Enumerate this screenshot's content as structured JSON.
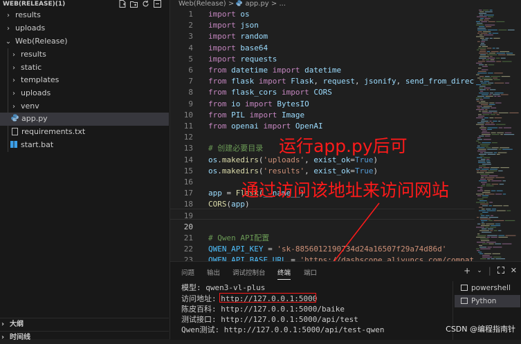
{
  "explorer": {
    "title": "WEB(RELEASE)(1)",
    "items": [
      {
        "label": "results",
        "type": "folder",
        "expanded": false,
        "depth": 0
      },
      {
        "label": "uploads",
        "type": "folder",
        "expanded": false,
        "depth": 0
      },
      {
        "label": "Web(Release)",
        "type": "folder",
        "expanded": true,
        "depth": 0
      },
      {
        "label": "results",
        "type": "folder",
        "expanded": false,
        "depth": 1
      },
      {
        "label": "static",
        "type": "folder",
        "expanded": false,
        "depth": 1
      },
      {
        "label": "templates",
        "type": "folder",
        "expanded": false,
        "depth": 1
      },
      {
        "label": "uploads",
        "type": "folder",
        "expanded": false,
        "depth": 1
      },
      {
        "label": "venv",
        "type": "folder",
        "expanded": false,
        "depth": 1
      },
      {
        "label": "app.py",
        "type": "python",
        "selected": true,
        "depth": 1
      },
      {
        "label": "requirements.txt",
        "type": "text",
        "depth": 1
      },
      {
        "label": "start.bat",
        "type": "windows",
        "depth": 1
      }
    ],
    "outline_label": "大纲",
    "timeline_label": "时间线"
  },
  "editor": {
    "breadcrumb_folder": "Web(Release)",
    "breadcrumb_sep": ">",
    "breadcrumb_file": "app.py",
    "breadcrumb_more": "> ...",
    "current_line": 20,
    "lines": [
      {
        "n": "1",
        "tokens": [
          {
            "t": "import",
            "c": "kw"
          },
          {
            "t": " os",
            "c": "vr"
          }
        ]
      },
      {
        "n": "2",
        "tokens": [
          {
            "t": "import",
            "c": "kw"
          },
          {
            "t": " json",
            "c": "vr"
          }
        ]
      },
      {
        "n": "3",
        "tokens": [
          {
            "t": "import",
            "c": "kw"
          },
          {
            "t": " random",
            "c": "vr"
          }
        ]
      },
      {
        "n": "4",
        "tokens": [
          {
            "t": "import",
            "c": "kw"
          },
          {
            "t": " base64",
            "c": "vr"
          }
        ]
      },
      {
        "n": "5",
        "tokens": [
          {
            "t": "import",
            "c": "kw"
          },
          {
            "t": " requests",
            "c": "vr"
          }
        ]
      },
      {
        "n": "6",
        "tokens": [
          {
            "t": "from",
            "c": "kw"
          },
          {
            "t": " datetime ",
            "c": "vr"
          },
          {
            "t": "import",
            "c": "kw"
          },
          {
            "t": " datetime",
            "c": "vr"
          }
        ]
      },
      {
        "n": "7",
        "tokens": [
          {
            "t": "from",
            "c": "kw"
          },
          {
            "t": " flask ",
            "c": "vr"
          },
          {
            "t": "import",
            "c": "kw"
          },
          {
            "t": " Flask",
            "c": "vr"
          },
          {
            "t": ", ",
            "c": "pl"
          },
          {
            "t": "request",
            "c": "vr"
          },
          {
            "t": ", ",
            "c": "pl"
          },
          {
            "t": "jsonify",
            "c": "vr"
          },
          {
            "t": ", ",
            "c": "pl"
          },
          {
            "t": "send_from_director",
            "c": "vr"
          }
        ]
      },
      {
        "n": "8",
        "tokens": [
          {
            "t": "from",
            "c": "kw"
          },
          {
            "t": " flask_cors ",
            "c": "vr"
          },
          {
            "t": "import",
            "c": "kw"
          },
          {
            "t": " CORS",
            "c": "vr"
          }
        ]
      },
      {
        "n": "9",
        "tokens": [
          {
            "t": "from",
            "c": "kw"
          },
          {
            "t": " io ",
            "c": "vr"
          },
          {
            "t": "import",
            "c": "kw"
          },
          {
            "t": " BytesIO",
            "c": "vr"
          }
        ]
      },
      {
        "n": "10",
        "tokens": [
          {
            "t": "from",
            "c": "kw"
          },
          {
            "t": " PIL ",
            "c": "vr"
          },
          {
            "t": "import",
            "c": "kw"
          },
          {
            "t": " Image",
            "c": "vr"
          }
        ]
      },
      {
        "n": "11",
        "tokens": [
          {
            "t": "from",
            "c": "kw"
          },
          {
            "t": " openai ",
            "c": "vr"
          },
          {
            "t": "import",
            "c": "kw"
          },
          {
            "t": " OpenAI",
            "c": "vr"
          }
        ]
      },
      {
        "n": "12",
        "tokens": []
      },
      {
        "n": "13",
        "tokens": [
          {
            "t": "# 创建必要目录",
            "c": "cm"
          }
        ]
      },
      {
        "n": "14",
        "tokens": [
          {
            "t": "os",
            "c": "vr"
          },
          {
            "t": ".",
            "c": "pl"
          },
          {
            "t": "makedirs",
            "c": "fn"
          },
          {
            "t": "(",
            "c": "pl"
          },
          {
            "t": "'uploads'",
            "c": "st"
          },
          {
            "t": ", ",
            "c": "pl"
          },
          {
            "t": "exist_ok",
            "c": "vr"
          },
          {
            "t": "=",
            "c": "pl"
          },
          {
            "t": "True",
            "c": "bl"
          },
          {
            "t": ")",
            "c": "pl"
          }
        ]
      },
      {
        "n": "15",
        "tokens": [
          {
            "t": "os",
            "c": "vr"
          },
          {
            "t": ".",
            "c": "pl"
          },
          {
            "t": "makedirs",
            "c": "fn"
          },
          {
            "t": "(",
            "c": "pl"
          },
          {
            "t": "'results'",
            "c": "st"
          },
          {
            "t": ", ",
            "c": "pl"
          },
          {
            "t": "exist_ok",
            "c": "vr"
          },
          {
            "t": "=",
            "c": "pl"
          },
          {
            "t": "True",
            "c": "bl"
          },
          {
            "t": ")",
            "c": "pl"
          }
        ]
      },
      {
        "n": "16",
        "tokens": []
      },
      {
        "n": "17",
        "tokens": [
          {
            "t": "app",
            "c": "vr"
          },
          {
            "t": " = ",
            "c": "pl"
          },
          {
            "t": "Flask",
            "c": "fn"
          },
          {
            "t": "(",
            "c": "pl"
          },
          {
            "t": "__name__",
            "c": "vr"
          },
          {
            "t": ")",
            "c": "pl"
          }
        ]
      },
      {
        "n": "18",
        "tokens": [
          {
            "t": "CORS",
            "c": "fn"
          },
          {
            "t": "(",
            "c": "pl"
          },
          {
            "t": "app",
            "c": "vr"
          },
          {
            "t": ")",
            "c": "pl"
          }
        ]
      },
      {
        "n": "19",
        "tokens": []
      },
      {
        "n": "20",
        "tokens": []
      },
      {
        "n": "21",
        "tokens": [
          {
            "t": "# Qwen API配置",
            "c": "cm"
          }
        ]
      },
      {
        "n": "22",
        "tokens": [
          {
            "t": "QWEN_API_KEY",
            "c": "cn"
          },
          {
            "t": " = ",
            "c": "pl"
          },
          {
            "t": "'sk-8856012190734d24a16507f29a74d86d'",
            "c": "st"
          }
        ]
      },
      {
        "n": "23",
        "tokens": [
          {
            "t": "QWEN_API_BASE_URL",
            "c": "cn"
          },
          {
            "t": " = ",
            "c": "pl"
          },
          {
            "t": "'",
            "c": "st"
          },
          {
            "t": "https://dashscope.aliyuncs.com/compatible",
            "c": "un"
          }
        ]
      },
      {
        "n": "24",
        "tokens": []
      }
    ]
  },
  "annotations": {
    "top": "运行app.py后可",
    "bottom": "通过访问该地址来访问网站"
  },
  "panel": {
    "tabs": [
      {
        "label": "问题",
        "active": false
      },
      {
        "label": "输出",
        "active": false
      },
      {
        "label": "调试控制台",
        "active": false
      },
      {
        "label": "终端",
        "active": true
      },
      {
        "label": "端口",
        "active": false
      }
    ],
    "terminal_lines": [
      "模型: qwen3-vl-plus",
      "访问地址: http://127.0.0.1:5000",
      "陈皮百科: http://127.0.0.1:5000/baike",
      "测试接口: http://127.0.0.1:5000/api/test",
      "Qwen测试: http://127.0.0.1:5000/api/test-qwen"
    ],
    "terminal_list": [
      {
        "label": "powershell",
        "selected": false
      },
      {
        "label": "Python",
        "selected": true
      }
    ]
  },
  "watermark": "CSDN @编程指南针",
  "colors": {
    "annotation": "#ff1a1a",
    "keyword": "#c586c0",
    "string": "#ce9178",
    "comment": "#6a9955",
    "variable": "#9cdcfe"
  }
}
